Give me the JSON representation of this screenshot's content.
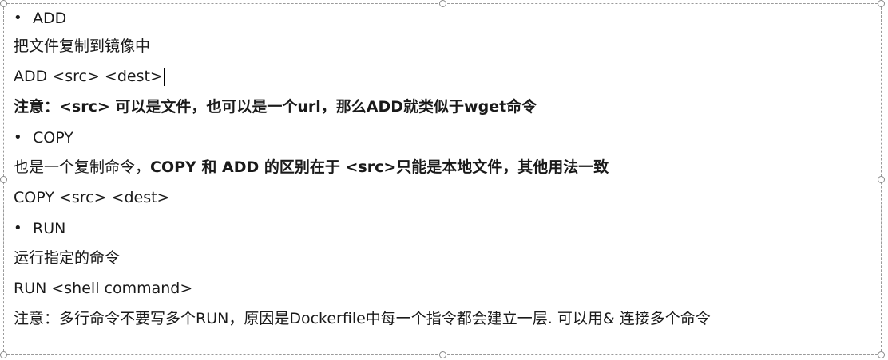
{
  "items": {
    "add_heading": {
      "bullet": "•",
      "label": "ADD"
    },
    "add_desc": "把文件复制到镜像中",
    "add_syntax": "ADD <src> <dest>",
    "add_note": "注意：<src> 可以是文件，也可以是一个url，那么ADD就类似于wget命令",
    "copy_heading": {
      "bullet": "•",
      "label": "COPY"
    },
    "copy_desc_plain": "也是一个复制命令，",
    "copy_desc_bold": "COPY 和 ADD 的区别在于 <src>只能是本地文件，其他用法一致",
    "copy_syntax": "COPY <src> <dest>",
    "run_heading": {
      "bullet": "•",
      "label": "RUN"
    },
    "run_desc": "运行指定的命令",
    "run_syntax": "RUN <shell command>",
    "run_note": "注意：多行命令不要写多个RUN，原因是Dockerfile中每一个指令都会建立一层. 可以用& 连接多个命令"
  }
}
